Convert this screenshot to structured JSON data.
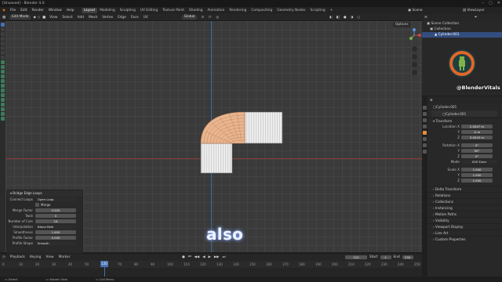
{
  "window": {
    "title": "[Unsaved] - Blender 4.0"
  },
  "menu": [
    "File",
    "Edit",
    "Render",
    "Window",
    "Help"
  ],
  "workspaces": [
    {
      "label": "Layout",
      "active": true
    },
    {
      "label": "Modeling"
    },
    {
      "label": "Sculpting"
    },
    {
      "label": "UV Editing"
    },
    {
      "label": "Texture Paint"
    },
    {
      "label": "Shading"
    },
    {
      "label": "Animation"
    },
    {
      "label": "Rendering"
    },
    {
      "label": "Compositing"
    },
    {
      "label": "Geometry Nodes"
    },
    {
      "label": "Scripting"
    }
  ],
  "scene": {
    "label": "Scene",
    "view_layer": "ViewLayer"
  },
  "viewport_header": {
    "mode": "Edit Mode",
    "items": [
      "View",
      "Select",
      "Add",
      "Mesh",
      "Vertex",
      "Edge",
      "Face",
      "UV"
    ],
    "orientation": "Global",
    "options": "Options"
  },
  "bridge_panel": {
    "title": "Bridge Edge Loops",
    "rows": [
      {
        "label": "Connect Loops",
        "value": "Open Loop",
        "type": "dropdown"
      },
      {
        "label": "",
        "value": "Merge",
        "type": "checkbox"
      },
      {
        "label": "Merge Factor",
        "value": "0.500",
        "type": "field"
      },
      {
        "label": "Twist",
        "value": "0",
        "type": "field"
      },
      {
        "label": "Number of Cuts",
        "value": "16",
        "type": "field"
      },
      {
        "label": "Interpolation",
        "value": "Blend Path",
        "type": "dropdown"
      },
      {
        "label": "Smoothness",
        "value": "1.650",
        "type": "field"
      },
      {
        "label": "Profile Factor",
        "value": "0.000",
        "type": "field"
      },
      {
        "label": "Profile Shape",
        "value": "Smooth",
        "type": "dropdown"
      }
    ]
  },
  "caption": "also",
  "timeline": {
    "items": [
      "Playback",
      "Keying",
      "View",
      "Marker"
    ],
    "current_frame": "120",
    "start_label": "Start",
    "start": "1",
    "end_label": "End",
    "end": "250",
    "ticks": [
      "0",
      "10",
      "20",
      "30",
      "40",
      "50",
      "60",
      "70",
      "80",
      "90",
      "100",
      "110",
      "120",
      "130",
      "140",
      "150",
      "160",
      "170",
      "180",
      "190",
      "200",
      "210",
      "220",
      "230",
      "240",
      "250"
    ]
  },
  "status": [
    "Select",
    "Rotate View",
    "Call Menu"
  ],
  "outliner": {
    "rows": [
      {
        "label": "Scene Collection",
        "sel": false
      },
      {
        "label": "Collection",
        "sel": false
      },
      {
        "label": "Cylinder.001",
        "sel": true
      }
    ]
  },
  "watermark": {
    "handle": "@BlenderVitals"
  },
  "properties": {
    "object_name": "Cylinder.001",
    "data_name": "Cylinder.001",
    "section": "Transform",
    "rows": [
      {
        "label": "Location X",
        "value": "2.0047 m"
      },
      {
        "label": "Y",
        "value": "-0 m"
      },
      {
        "label": "Z",
        "value": "3.0043 m"
      },
      {
        "label": "Rotation X",
        "value": "0°"
      },
      {
        "label": "Y",
        "value": "90°"
      },
      {
        "label": "Z",
        "value": "0°"
      },
      {
        "label": "Mode",
        "value": "XYZ Euler"
      },
      {
        "label": "Scale X",
        "value": "1.000"
      },
      {
        "label": "Y",
        "value": "1.000"
      },
      {
        "label": "Z",
        "value": "1.000"
      }
    ],
    "sections": [
      "Delta Transform",
      "Relations",
      "Collections",
      "Instancing",
      "Motion Paths",
      "Visibility",
      "Viewport Display",
      "Line Art",
      "Custom Properties"
    ]
  },
  "colors": {
    "accent": "#4772b3",
    "selection_orange": "#e8b48a",
    "mesh_white": "#eaeaea"
  }
}
